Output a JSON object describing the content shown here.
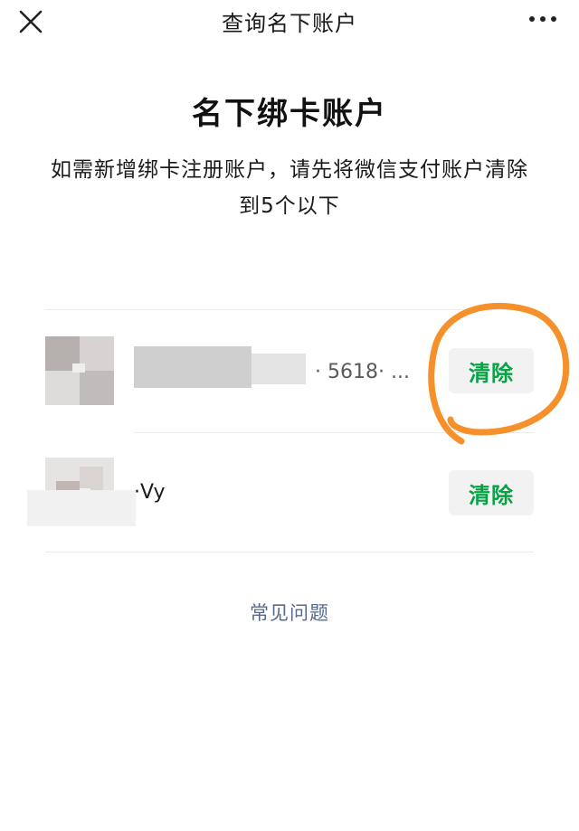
{
  "nav": {
    "title": "查询名下账户",
    "close_icon": "close-icon",
    "more_icon": "more-dots-icon"
  },
  "main": {
    "heading": "名下绑卡账户",
    "notice": "如需新增绑卡注册账户，请先将微信支付账户清除到5个以下"
  },
  "accounts": [
    {
      "name_visible": "· 5618· ...",
      "button": "清除"
    },
    {
      "name_visible": "·Vy",
      "button": "清除"
    }
  ],
  "faq": {
    "label": "常见问题"
  },
  "colors": {
    "accent_green": "#07a244",
    "link_blue": "#57698c",
    "annotation_orange": "#f5902a"
  }
}
